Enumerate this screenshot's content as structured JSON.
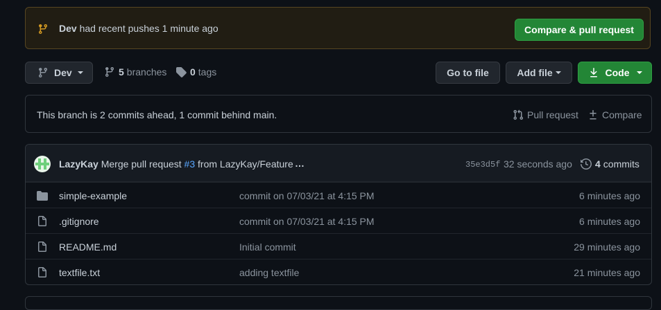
{
  "banner": {
    "branch": "Dev",
    "message": "had recent pushes 1 minute ago",
    "button_label": "Compare & pull request",
    "icon": "git-branch-icon"
  },
  "toolbar": {
    "branch_label": "Dev",
    "branches_count": "5",
    "branches_label": "branches",
    "tags_count": "0",
    "tags_label": "tags",
    "goto_label": "Go to file",
    "addfile_label": "Add file",
    "code_label": "Code"
  },
  "compare": {
    "text": "This branch is 2 commits ahead, 1 commit behind main.",
    "pull_request_label": "Pull request",
    "compare_label": "Compare"
  },
  "latest_commit": {
    "author": "LazyKay",
    "message_before": "Merge pull request",
    "pr_ref": "#3",
    "message_after": "from LazyKay/Feature",
    "ellipsis": "…",
    "sha": "35e3d5f",
    "time": "32 seconds ago",
    "commits_count": "4",
    "commits_label": "commits"
  },
  "files": [
    {
      "type": "folder",
      "name": "simple-example",
      "commit": "commit on 07/03/21 at 4:15 PM",
      "age": "6 minutes ago"
    },
    {
      "type": "file",
      "name": ".gitignore",
      "commit": "commit on 07/03/21 at 4:15 PM",
      "age": "6 minutes ago"
    },
    {
      "type": "file",
      "name": "README.md",
      "commit": "Initial commit",
      "age": "29 minutes ago"
    },
    {
      "type": "file",
      "name": "textfile.txt",
      "commit": "adding textfile",
      "age": "21 minutes ago"
    }
  ],
  "colors": {
    "background": "#0d1117",
    "banner_bg": "#211d13",
    "accent_green": "#238636",
    "link_blue": "#58a6ff",
    "muted": "#8b949e",
    "branch_icon": "#d29922"
  }
}
